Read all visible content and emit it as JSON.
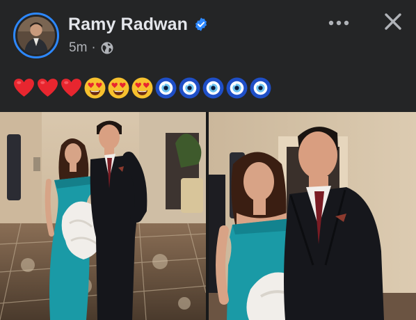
{
  "post": {
    "author_name": "Ramy Radwan",
    "verified": true,
    "timestamp": "5m",
    "separator": "·",
    "audience_icon": "globe-icon",
    "caption_emojis": [
      "red-heart",
      "red-heart",
      "red-heart",
      "heart-eyes",
      "heart-eyes",
      "heart-eyes",
      "nazar-amulet",
      "nazar-amulet",
      "nazar-amulet",
      "nazar-amulet",
      "nazar-amulet"
    ],
    "photo_count": 2
  },
  "colors": {
    "background": "#242526",
    "text_primary": "#e4e6eb",
    "text_secondary": "#b0b3b8",
    "verified_blue": "#2d88ff",
    "dress_teal": "#1a9aa6"
  },
  "icons": {
    "more": "more-horizontal-icon",
    "close": "close-icon",
    "verified": "verified-badge-icon"
  }
}
